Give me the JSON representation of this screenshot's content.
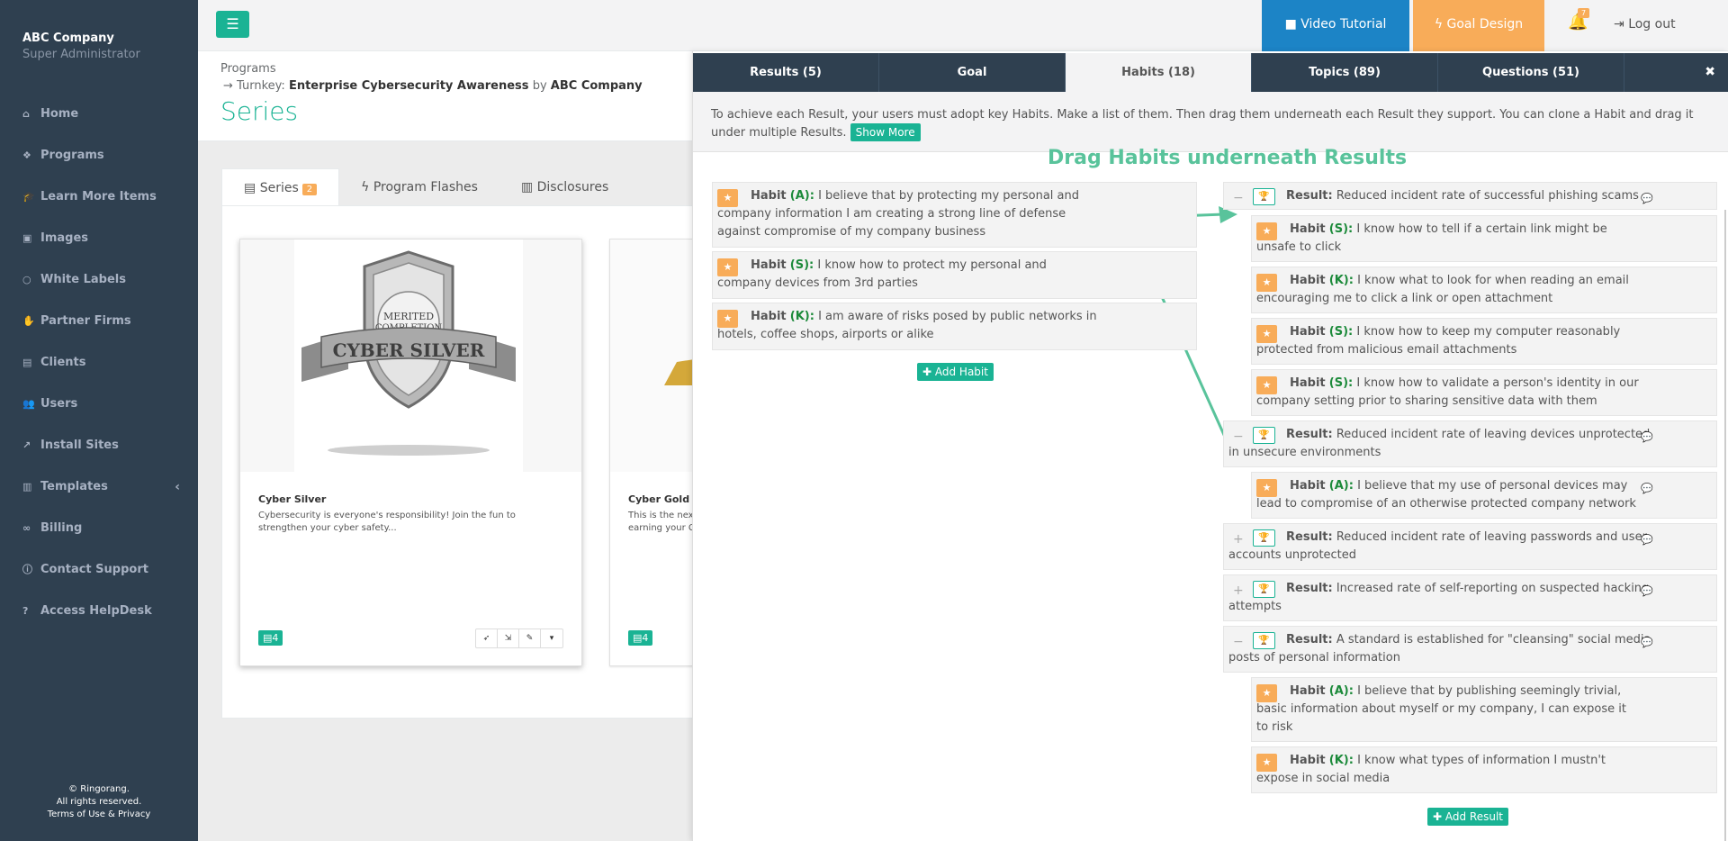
{
  "sidebar": {
    "company": "ABC Company",
    "role": "Super Administrator",
    "items": [
      {
        "label": "Home",
        "icon": "home-icon",
        "glyph": "⌂"
      },
      {
        "label": "Programs",
        "icon": "cubes-icon",
        "glyph": "❖"
      },
      {
        "label": "Learn More Items",
        "icon": "graduation-cap-icon",
        "glyph": "🎓"
      },
      {
        "label": "Images",
        "icon": "image-icon",
        "glyph": "▣"
      },
      {
        "label": "White Labels",
        "icon": "circle-icon",
        "glyph": "○"
      },
      {
        "label": "Partner Firms",
        "icon": "handshake-icon",
        "glyph": "✋"
      },
      {
        "label": "Clients",
        "icon": "briefcase-icon",
        "glyph": "▤"
      },
      {
        "label": "Users",
        "icon": "users-icon",
        "glyph": "👥"
      },
      {
        "label": "Install Sites",
        "icon": "external-link-icon",
        "glyph": "↗"
      },
      {
        "label": "Templates",
        "icon": "file-icon",
        "glyph": "▥"
      },
      {
        "label": "Billing",
        "icon": "link-icon",
        "glyph": "∞"
      },
      {
        "label": "Contact Support",
        "icon": "info-icon",
        "glyph": "ⓘ"
      },
      {
        "label": "Access HelpDesk",
        "icon": "question-icon",
        "glyph": "?"
      }
    ],
    "footer": {
      "line1": "© Ringorang.",
      "line2": "All rights reserved.",
      "line3": "Terms of Use & Privacy"
    }
  },
  "topbar": {
    "video_label": "Video Tutorial",
    "goal_label": "Goal Design",
    "notifications": "7",
    "logout_label": "Log out"
  },
  "heading": {
    "crumb1": "Programs",
    "crumb2_prefix": "Turnkey:",
    "crumb2_program": "Enterprise Cybersecurity Awareness",
    "crumb2_by": "by",
    "crumb2_company": "ABC Company",
    "title": "Series"
  },
  "content_tabs": [
    {
      "label": "Series",
      "badge": "2"
    },
    {
      "label": "Program Flashes"
    },
    {
      "label": "Disclosures"
    }
  ],
  "cards": [
    {
      "title": "Cyber Silver",
      "desc": "Cybersecurity is everyone's responsibility! Join the fun to strengthen your cyber safety...",
      "count": "4",
      "badge_text": "CYBER SILVER",
      "seal_text": "MERITED COMPLETION"
    },
    {
      "title": "Cyber Gold",
      "desc": "This is the nex earning your C",
      "count": "4"
    }
  ],
  "panel": {
    "tabs": [
      "Results (5)",
      "Goal",
      "Habits (18)",
      "Topics (89)",
      "Questions (51)"
    ],
    "active_tab": 2,
    "close": "✖",
    "intro": "To achieve each Result, your users must adopt key Habits. Make a list of them. Then drag them underneath each Result they support. You can clone a Habit and drag it under multiple Results.",
    "show_more": "Show More",
    "hint": "Drag Habits underneath Results",
    "habit_word": "Habit",
    "result_word": "Result:",
    "left_habits": [
      {
        "code": "(A):",
        "text": "I believe that by protecting my personal and company information I am creating a strong line of defense against compromise of my company business"
      },
      {
        "code": "(S):",
        "text": "I know how to protect my personal and company devices from 3rd parties"
      },
      {
        "code": "(K):",
        "text": "I am aware of risks posed by public networks in hotels, coffee shops, airports or alike"
      }
    ],
    "add_habit": "Add Habit",
    "results": [
      {
        "text": "Reduced incident rate of successful phishing scams",
        "toggle": "−"
      },
      {
        "text": "Reduced incident rate of leaving devices unprotected in unsecure environments",
        "toggle": "−"
      },
      {
        "text": "Reduced incident rate of leaving passwords and user accounts unprotected",
        "toggle": "+"
      },
      {
        "text": "Increased rate of self-reporting on suspected hacking attempts",
        "toggle": "+"
      },
      {
        "text": "A standard is established for \"cleansing\" social media posts of personal information",
        "toggle": "−"
      }
    ],
    "result_habits": [
      {
        "code": "(S):",
        "text": "I know how to tell if a certain link might be unsafe to click"
      },
      {
        "code": "(K):",
        "text": "I know what to look for when reading an email encouraging me to click a link or open attachment"
      },
      {
        "code": "(S):",
        "text": "I know how to keep my computer reasonably protected from malicious email attachments"
      },
      {
        "code": "(S):",
        "text": "I know how to validate a person's identity in our company setting prior to sharing sensitive data with them"
      },
      {
        "code": "(A):",
        "text": "I believe that my use of personal devices may lead to compromise of an otherwise protected company network"
      },
      {
        "code": "(A):",
        "text": "I believe that by publishing seemingly trivial, basic information about myself or my company, I can expose it to risk"
      },
      {
        "code": "(K):",
        "text": "I know what types of information I mustn't expose in social media"
      }
    ],
    "add_result": "Add Result"
  },
  "colors": {
    "sidebar": "#2f4050",
    "accent": "#1ab394",
    "warning": "#f8ac59",
    "primary": "#1c84c6",
    "arrow": "#59c39b"
  }
}
